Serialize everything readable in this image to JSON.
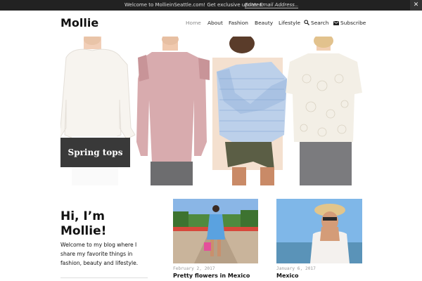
{
  "topbar": {
    "message": "Welcome to MollieinSeattle.com! Get exclusive updates:",
    "email_placeholder": "Enter Email Address...",
    "close_label": "✕"
  },
  "header": {
    "site_title": "Mollie",
    "nav": [
      "Home",
      "About",
      "Fashion",
      "Beauty",
      "Lifestyle",
      "Search",
      "Subscribe"
    ]
  },
  "hero": {
    "label": "Spring tops"
  },
  "intro": {
    "title": "Hi, I’m Mollie!",
    "text": "Welcome to my blog where I share my favorite things in fashion, beauty and lifestyle."
  },
  "posts": [
    {
      "date": "February 2, 2017",
      "title": "Pretty flowers in Mexico"
    },
    {
      "date": "January 6, 2017",
      "title": "Mexico"
    }
  ],
  "colors": {
    "topbar_bg": "#222222",
    "nav_active": "#888888"
  },
  "icons": [
    "search-icon",
    "mail-icon",
    "close-icon"
  ]
}
